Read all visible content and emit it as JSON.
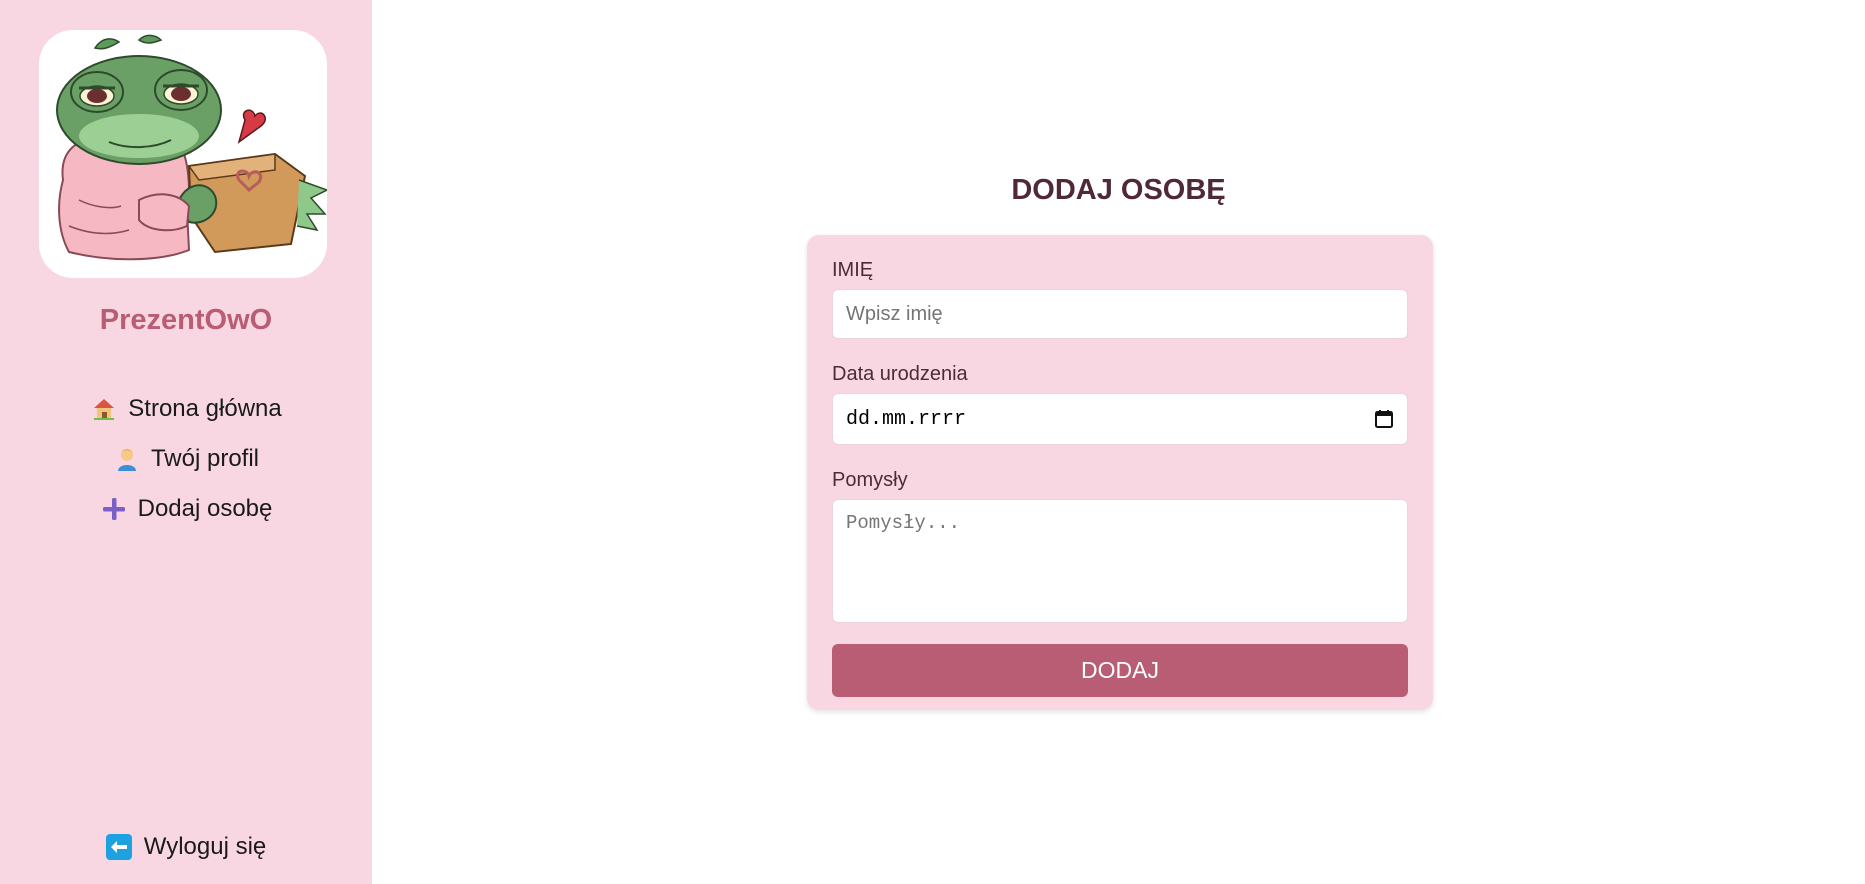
{
  "sidebar": {
    "brand": "PrezentOwO",
    "nav": [
      {
        "label": "Strona główna",
        "icon": "house-icon"
      },
      {
        "label": "Twój profil",
        "icon": "person-icon"
      },
      {
        "label": "Dodaj osobę",
        "icon": "plus-icon"
      }
    ],
    "logout": {
      "label": "Wyloguj się",
      "icon": "left-arrow-icon"
    }
  },
  "main": {
    "title": "DODAJ OSOBĘ",
    "form": {
      "name_label": "IMIĘ",
      "name_placeholder": "Wpisz imię",
      "date_label": "Data urodzenia",
      "date_placeholder": "dd.mm.rrrr",
      "ideas_label": "Pomysły",
      "ideas_placeholder": "Pomysły...",
      "submit_label": "DODAJ"
    }
  },
  "colors": {
    "sidebar_bg": "#f8d7e3",
    "brand": "#b85d73",
    "title": "#4f2a35",
    "button": "#b85d73"
  }
}
